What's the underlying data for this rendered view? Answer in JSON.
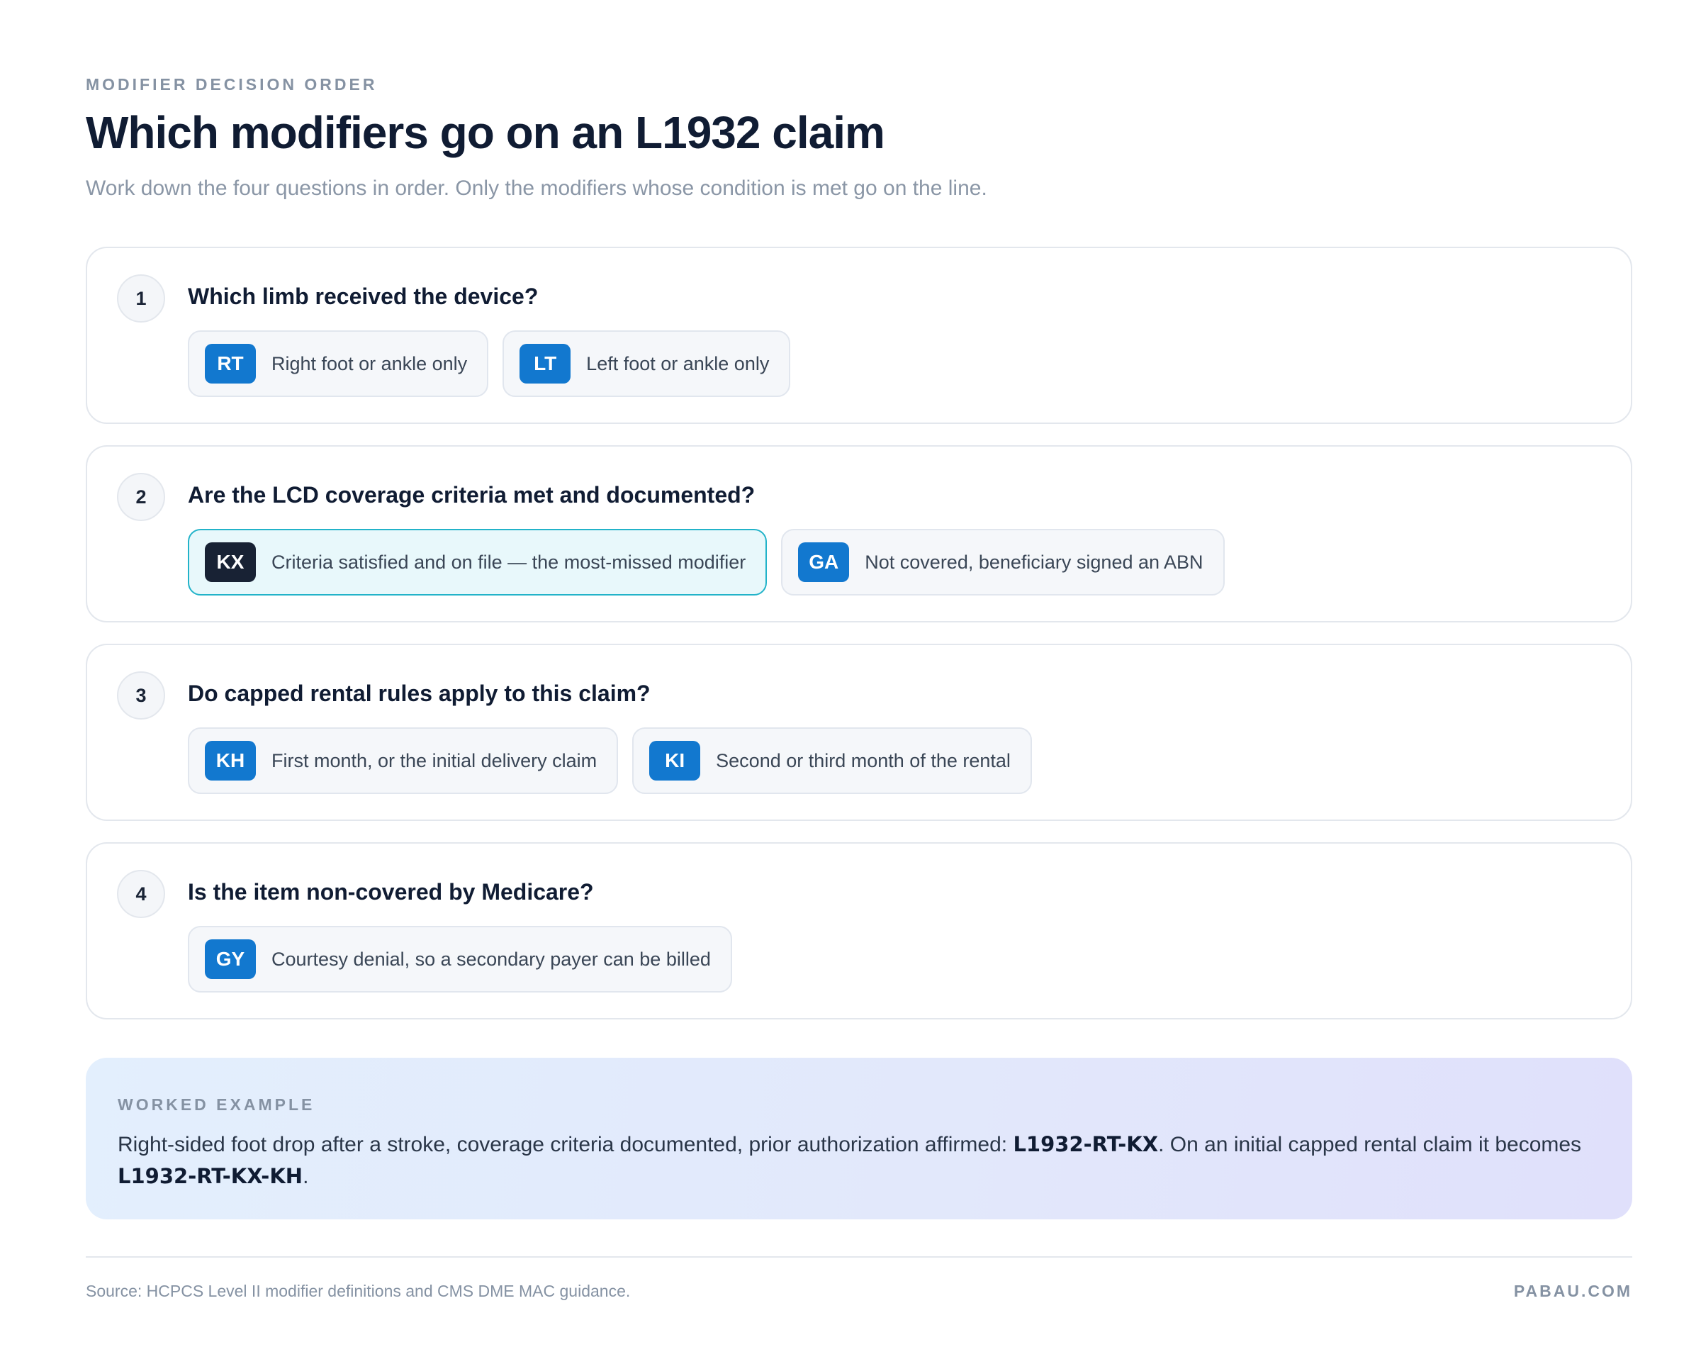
{
  "header": {
    "eyebrow": "MODIFIER DECISION ORDER",
    "title": "Which modifiers go on an L1932 claim",
    "subtitle": "Work down the four questions in order. Only the modifiers whose condition is met go on the line."
  },
  "steps": [
    {
      "number": "1",
      "question": "Which limb received the device?",
      "options": [
        {
          "code": "RT",
          "text": "Right foot or ankle only"
        },
        {
          "code": "LT",
          "text": "Left foot or ankle only"
        }
      ]
    },
    {
      "number": "2",
      "question": "Are the LCD coverage criteria met and documented?",
      "options": [
        {
          "code": "KX",
          "text": "Criteria satisfied and on file — the most-missed modifier",
          "highlighted": true
        },
        {
          "code": "GA",
          "text": "Not covered, beneficiary signed an ABN"
        }
      ]
    },
    {
      "number": "3",
      "question": "Do capped rental rules apply to this claim?",
      "options": [
        {
          "code": "KH",
          "text": "First month, or the initial delivery claim"
        },
        {
          "code": "KI",
          "text": "Second or third month of the rental"
        }
      ]
    },
    {
      "number": "4",
      "question": "Is the item non-covered by Medicare?",
      "options": [
        {
          "code": "GY",
          "text": "Courtesy denial, so a secondary payer can be billed"
        }
      ]
    }
  ],
  "example": {
    "label": "WORKED EXAMPLE",
    "text_before": "Right-sided foot drop after a stroke, coverage criteria documented, prior authorization affirmed: ",
    "code_1": "L1932-RT-KX",
    "text_middle": ". On an initial capped rental claim it becomes ",
    "code_2": "L1932-RT-KX-KH",
    "text_after": "."
  },
  "footer": {
    "source": "Source: HCPCS Level II modifier definitions and CMS DME MAC guidance.",
    "brand": "PABAU.COM"
  },
  "colors": {
    "badge_blue": "#1278cf",
    "badge_dark": "#182234",
    "highlight_border": "#22b3c9",
    "highlight_bg": "#e8f8fb"
  }
}
